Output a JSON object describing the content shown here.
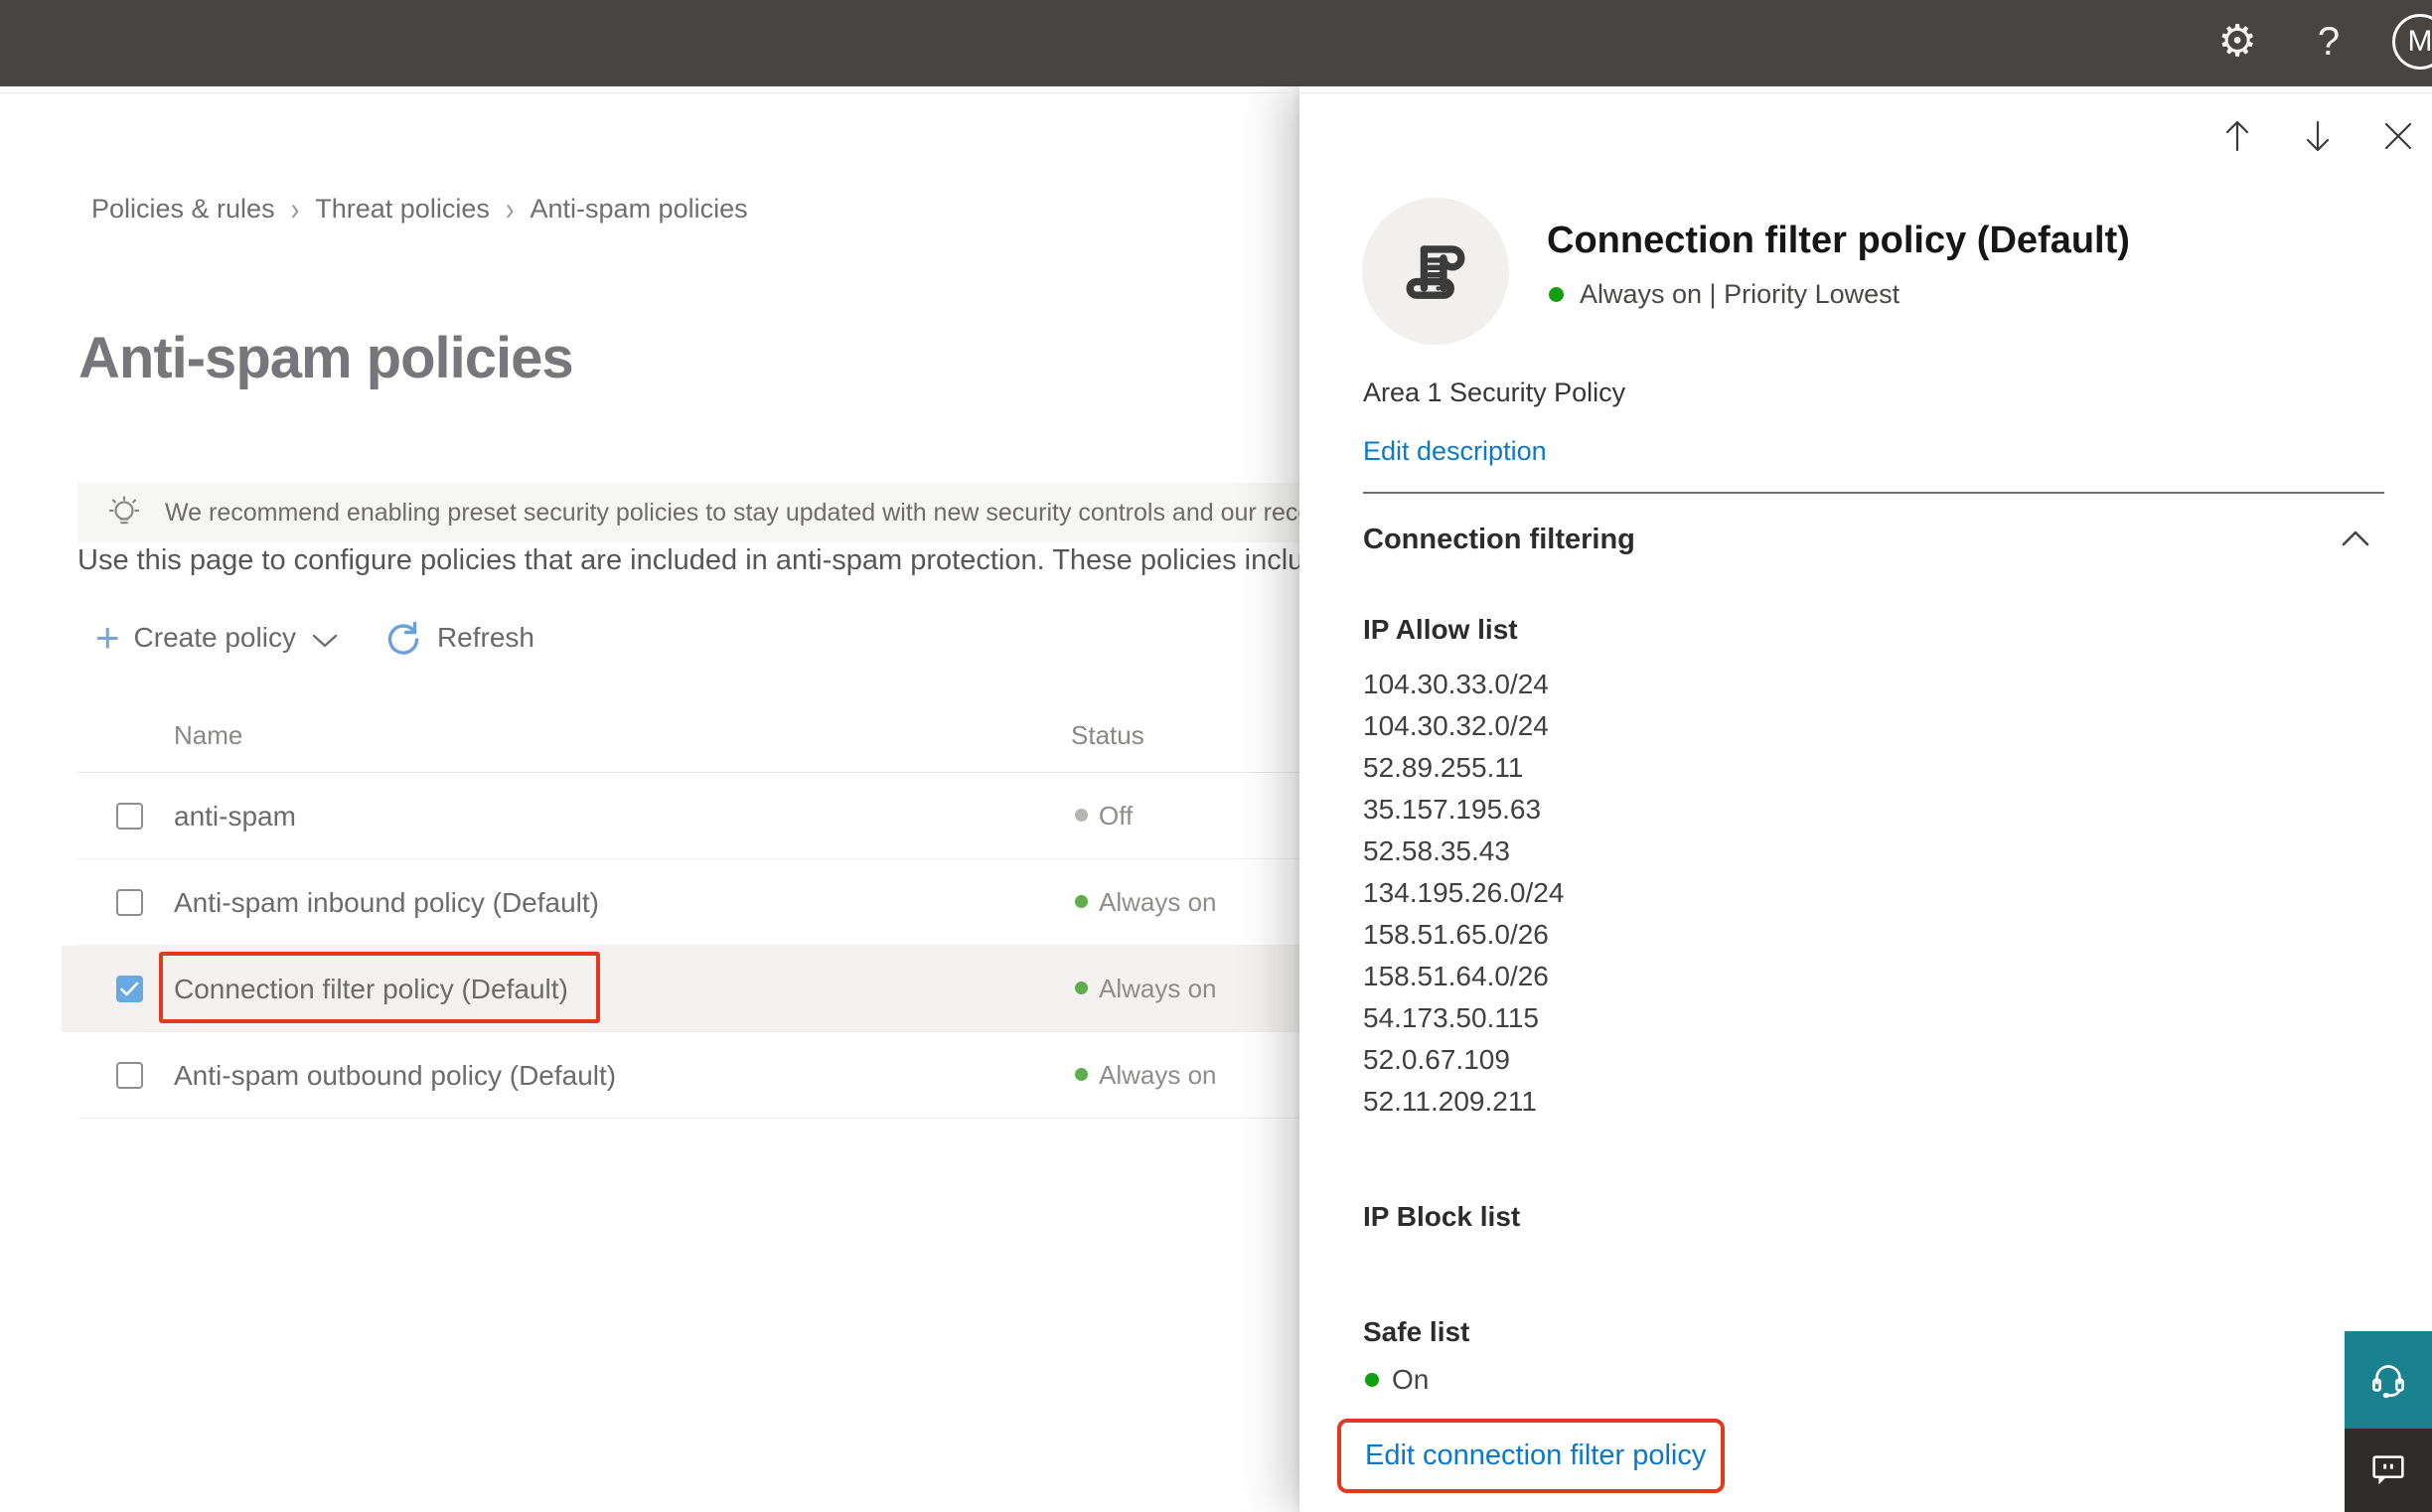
{
  "topbar": {
    "help_glyph": "?",
    "avatar_initial": "M"
  },
  "breadcrumb": {
    "items": [
      "Policies & rules",
      "Threat policies",
      "Anti-spam policies"
    ]
  },
  "page": {
    "title": "Anti-spam policies",
    "banner_text": "We recommend enabling preset security policies to stay updated with new security controls and our recomme",
    "description": "Use this page to configure policies that are included in anti-spam protection. These policies include"
  },
  "toolbar": {
    "create_policy_label": "Create policy",
    "refresh_label": "Refresh"
  },
  "table": {
    "columns": [
      "Name",
      "Status"
    ],
    "rows": [
      {
        "name": "anti-spam",
        "status": "Off"
      },
      {
        "name": "Anti-spam inbound policy (Default)",
        "status": "Always on"
      },
      {
        "name": "Connection filter policy (Default)",
        "status": "Always on"
      },
      {
        "name": "Anti-spam outbound policy (Default)",
        "status": "Always on"
      }
    ]
  },
  "panel": {
    "title": "Connection filter policy (Default)",
    "status_line": "Always on | Priority Lowest",
    "description": "Area 1 Security Policy",
    "edit_description_label": "Edit description",
    "section_label": "Connection filtering",
    "ip_allow_title": "IP Allow list",
    "ip_allow": [
      "104.30.33.0/24",
      "104.30.32.0/24",
      "52.89.255.11",
      "35.157.195.63",
      "52.58.35.43",
      "134.195.26.0/24",
      "158.51.65.0/26",
      "158.51.64.0/26",
      "54.173.50.115",
      "52.0.67.109",
      "52.11.209.211"
    ],
    "ip_block_title": "IP Block list",
    "safe_list_title": "Safe list",
    "safe_list_status": "On",
    "edit_link_label": "Edit connection filter policy"
  },
  "colors": {
    "topbar": "#484442",
    "accent_blue": "#0b79c9",
    "annotation_red": "#e0391f",
    "status_green": "#5fae4e",
    "panel_green": "#12a10e",
    "status_gray": "#b7b5b3",
    "checkbox_blue": "#69a9e2",
    "help_teal": "#1a818e",
    "feedback_dark": "#2f2d2c"
  }
}
